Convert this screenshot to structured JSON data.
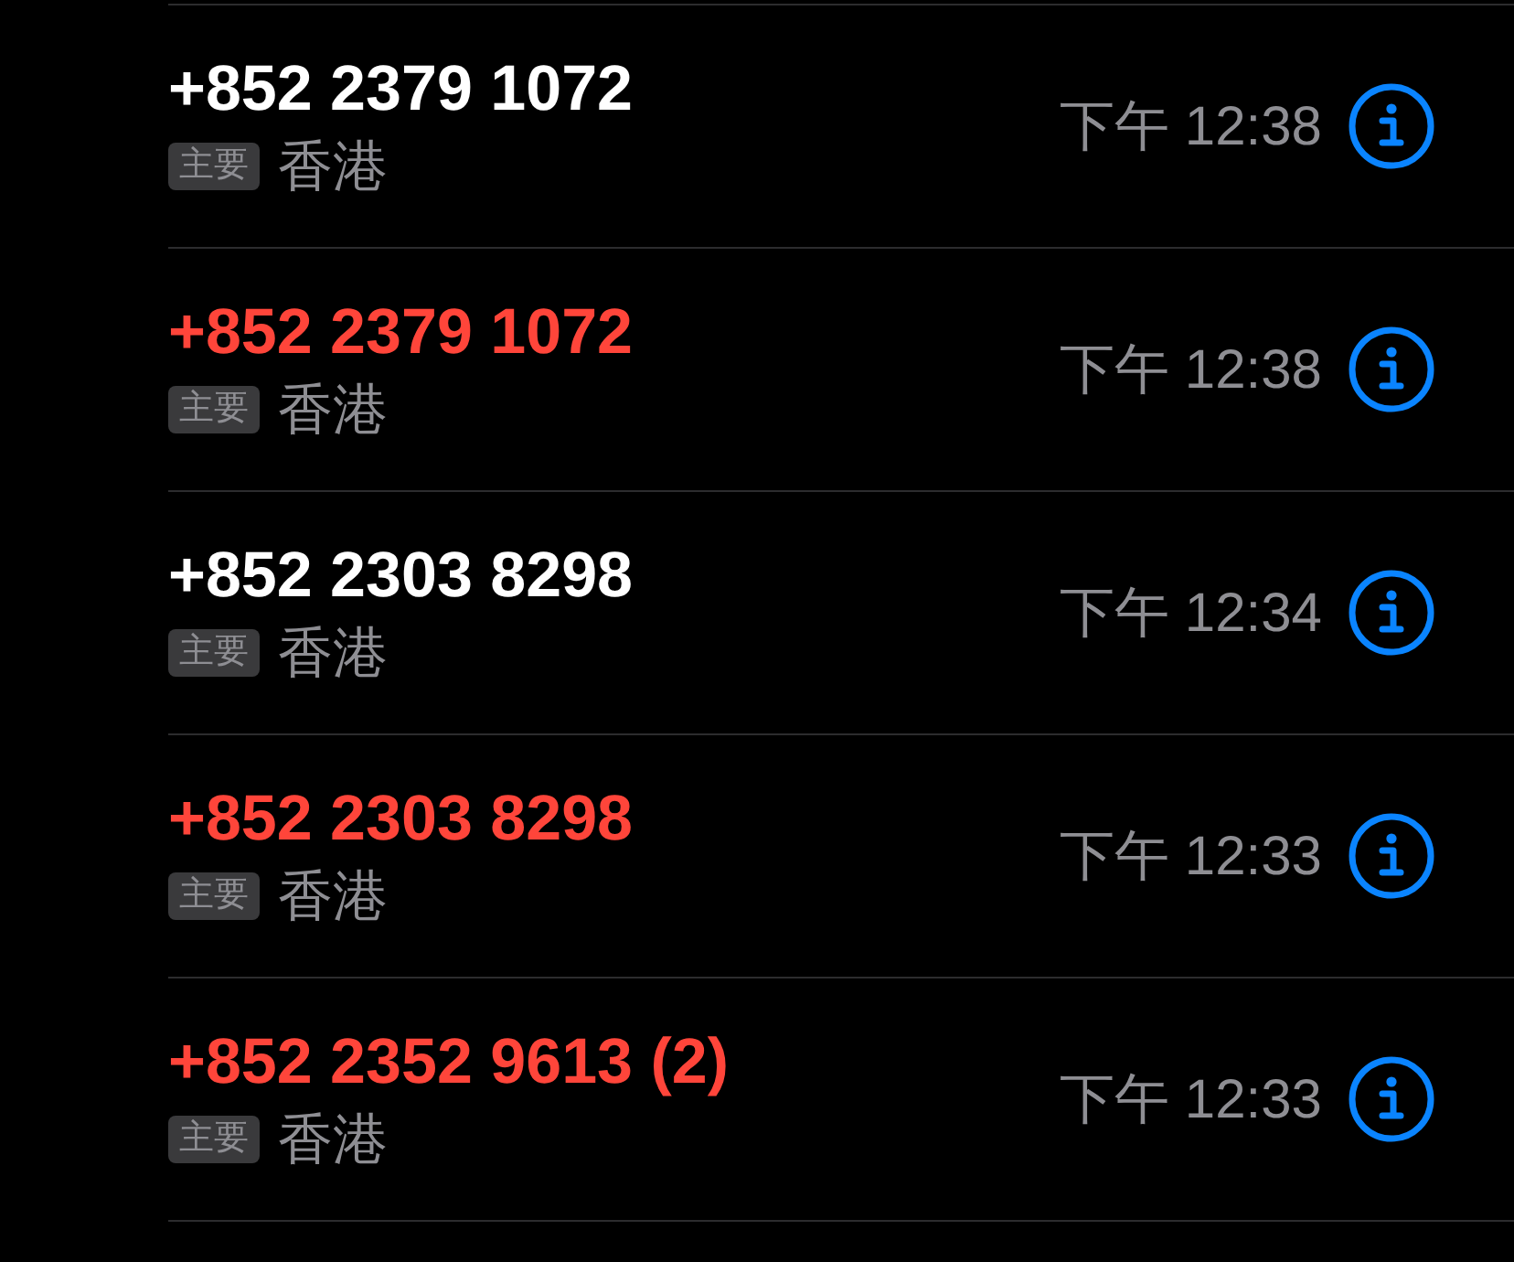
{
  "calls": [
    {
      "number": "+852 2379 1072",
      "missed": false,
      "tag": "主要",
      "region": "香港",
      "time": "下午 12:38"
    },
    {
      "number": "+852 2379 1072",
      "missed": true,
      "tag": "主要",
      "region": "香港",
      "time": "下午 12:38"
    },
    {
      "number": "+852 2303 8298",
      "missed": false,
      "tag": "主要",
      "region": "香港",
      "time": "下午 12:34"
    },
    {
      "number": "+852 2303 8298",
      "missed": true,
      "tag": "主要",
      "region": "香港",
      "time": "下午 12:33"
    },
    {
      "number": "+852 2352 9613 (2)",
      "missed": true,
      "tag": "主要",
      "region": "香港",
      "time": "下午 12:33"
    }
  ]
}
